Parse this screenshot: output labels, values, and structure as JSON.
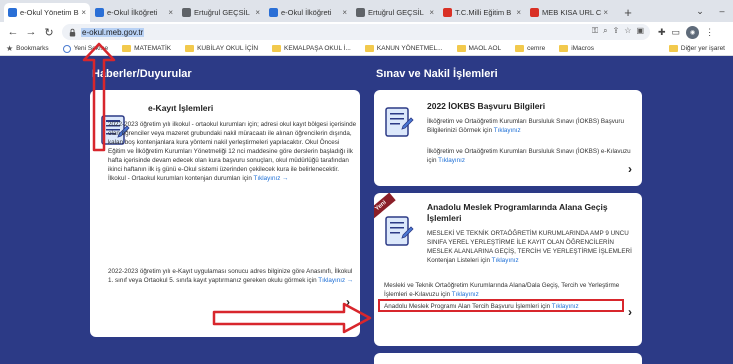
{
  "browser": {
    "tabs": [
      {
        "label": "e-Okul Yönetim B",
        "fav_color": "#2a6fd6",
        "active": true
      },
      {
        "label": "e-Okul İlköğreti",
        "fav_color": "#2a6fd6",
        "active": false
      },
      {
        "label": "Ertuğrul GEÇSİL",
        "fav_color": "#5f6368",
        "active": false
      },
      {
        "label": "e-Okul İlköğreti",
        "fav_color": "#2a6fd6",
        "active": false
      },
      {
        "label": "Ertuğrul GEÇSİL",
        "fav_color": "#5f6368",
        "active": false
      },
      {
        "label": "T.C.Milli Eğitim B",
        "fav_color": "#d93025",
        "active": false
      },
      {
        "label": "MEB KISA URL C",
        "fav_color": "#d93025",
        "active": false
      }
    ],
    "new_tab": "+",
    "url": "e-okul.meb.gov.tr",
    "bookmarks": [
      {
        "label": "Bookmarks",
        "icon": "star-icon"
      },
      {
        "label": "Yeni Sekme",
        "icon": "globe-icon"
      },
      {
        "label": "MATEMATİK",
        "icon": "folder-icon"
      },
      {
        "label": "KUBİLAY OKUL İÇİN",
        "icon": "folder-icon"
      },
      {
        "label": "KEMALPAŞA OKUL İ...",
        "icon": "folder-icon"
      },
      {
        "label": "KANUN YÖNETMEL...",
        "icon": "folder-icon"
      },
      {
        "label": "MAOL AOL",
        "icon": "folder-icon"
      },
      {
        "label": "cemre",
        "icon": "folder-icon"
      },
      {
        "label": "iMacros",
        "icon": "folder-icon"
      }
    ],
    "other_bookmarks": "Diğer yer işaret"
  },
  "news": {
    "heading": "Haberler/Duyurular",
    "card_title": "e-Kayıt İşlemleri",
    "paragraph1": "2022-2023 öğretim yılı ilkokul - ortaokul kurumları için; adresi okul kayıt bölgesi içerisinde olan öğrenciler veya mazeret grubundaki nakil müracaatı ile alınan öğrencilerin dışında, kalan boş kontenjanlara kura yöntemi nakil yerleştirmeleri yapılacaktır. Okul Öncesi Eğitim ve İlköğretim Kurumları Yönetmeliği 12 nci maddesine göre derslerin başladığı ilk hafta içerisinde devam edecek olan kura başvuru sonuçları, okul müdürlüğü tarafından ikinci haftanın ilk iş günü e-Okul sistemi üzerinden çekilecek kura ile belirlenecektir. İlkokul - Ortaokul kurumları kontenjan durumları için",
    "paragraph1_link": "Tıklayınız →",
    "paragraph2": "2022-2023 öğretim yılı e-Kayıt uygulaması sonucu adres bilginize göre Anasınıfı, İlkokul 1. sınıf veya Ortaokul 5. sınıfa kayıt yaptırmanız gereken okulu görmek için",
    "paragraph2_link": "Tıklayınız →"
  },
  "exams": {
    "heading": "Sınav ve Nakil İşlemleri",
    "card1": {
      "title": "2022 İOKBS Başvuru Bilgileri",
      "text1": "İlköğretim ve Ortaöğretim Kurumları Bursluluk Sınavı (İOKBS) Başvuru Bilgilerinizi Görmek için",
      "link1": "Tıklayınız",
      "text2": "İlköğretim ve Ortaöğretim Kurumları Bursluluk Sınavı (İOKBS) e-Kılavuzu için",
      "link2": "Tıklayınız"
    },
    "card2": {
      "ribbon": "Yeni",
      "title": "Anadolu Meslek Programlarında Alana Geçiş İşlemleri",
      "text1": "MESLEKİ VE TEKNİK ORTAÖĞRETİM KURUMLARINDA AMP 9 UNCU SINIFA YEREL YERLEŞTİRME İLE KAYIT OLAN ÖĞRENCİLERİN MESLEK ALANLARINA GEÇİŞ, TERCİH VE YERLEŞTİRME İŞLEMLERİ Kontenjan Listeleri için",
      "link1": "Tıklayınız",
      "text2": "Mesleki ve Teknik Ortaöğretim Kurumlarında Alana/Dala Geçiş, Tercih ve Yerleştirme İşlemleri e-Kılavuzu için",
      "link2": "Tıklayınız",
      "text3": "Anadolu Meslek Programı Alan Tercih Başvuru İşlemleri için",
      "link3": "Tıklayınız"
    }
  },
  "colors": {
    "page_bg": "#2c3a86",
    "arrow_red": "#d8262c",
    "link": "#1d6fd6"
  }
}
